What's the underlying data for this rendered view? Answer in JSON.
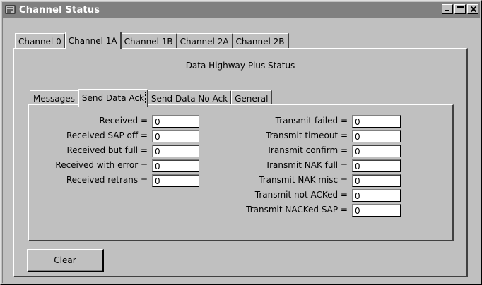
{
  "window": {
    "title": "Channel Status"
  },
  "channel_tabs": [
    {
      "label": "Channel 0",
      "active": false
    },
    {
      "label": "Channel 1A",
      "active": true
    },
    {
      "label": "Channel 1B",
      "active": false
    },
    {
      "label": "Channel 2A",
      "active": false
    },
    {
      "label": "Channel 2B",
      "active": false
    }
  ],
  "panel": {
    "heading": "Data Highway Plus Status"
  },
  "status_tabs": [
    {
      "label": "Messages",
      "active": false
    },
    {
      "label": "Send Data Ack",
      "active": true
    },
    {
      "label": "Send Data No Ack",
      "active": false
    },
    {
      "label": "General",
      "active": false
    }
  ],
  "left_stats": [
    {
      "label": "Received =",
      "value": "0"
    },
    {
      "label": "Received SAP off =",
      "value": "0"
    },
    {
      "label": "Received but full =",
      "value": "0"
    },
    {
      "label": "Received with error =",
      "value": "0"
    },
    {
      "label": "Received retrans =",
      "value": "0"
    }
  ],
  "right_stats": [
    {
      "label": "Transmit failed =",
      "value": "0"
    },
    {
      "label": "Transmit timeout =",
      "value": "0"
    },
    {
      "label": "Transmit confirm =",
      "value": "0"
    },
    {
      "label": "Transmit NAK full =",
      "value": "0"
    },
    {
      "label": "Transmit NAK misc =",
      "value": "0"
    },
    {
      "label": "Transmit not ACKed =",
      "value": "0"
    },
    {
      "label": "Transmit NACKed SAP =",
      "value": "0"
    }
  ],
  "buttons": {
    "clear_label": "Clear"
  }
}
